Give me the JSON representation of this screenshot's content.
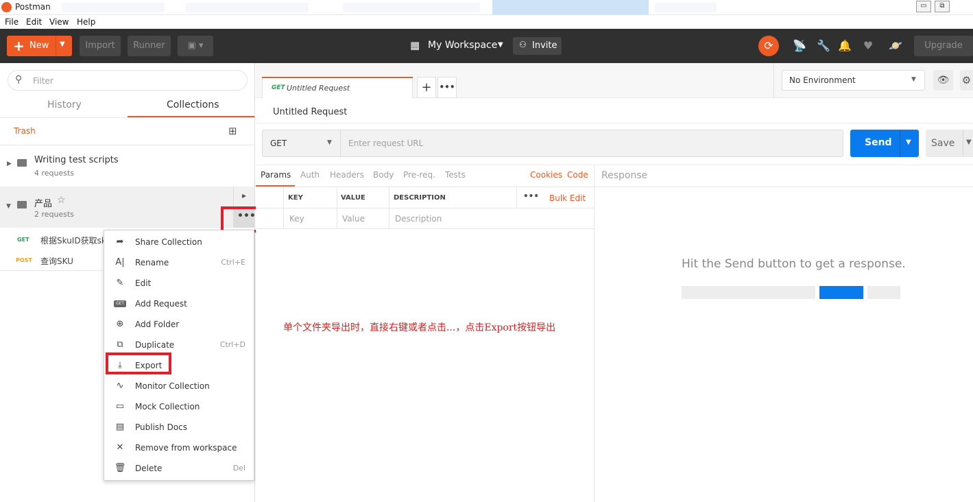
{
  "window": {
    "title": "Postman",
    "minimize": "▭",
    "restore": "⧉"
  },
  "menubar": {
    "file": "File",
    "edit": "Edit",
    "view": "View",
    "help": "Help"
  },
  "header": {
    "new_label": "New",
    "import_label": "Import",
    "runner_label": "Runner",
    "workspace": "My Workspace",
    "invite": "Invite",
    "upgrade": "Upgrade"
  },
  "sidebar": {
    "filter_placeholder": "Filter",
    "tabs": {
      "history": "History",
      "collections": "Collections"
    },
    "trash": "Trash",
    "collections": [
      {
        "name": "Writing test scripts",
        "count": "4 requests"
      },
      {
        "name": "产品",
        "count": "2 requests"
      }
    ],
    "requests": [
      {
        "method": "GET",
        "name": "根据SkuID获取sk"
      },
      {
        "method": "POST",
        "name": "查询SKU"
      }
    ]
  },
  "context_menu": {
    "items": [
      {
        "icon": "➦",
        "label": "Share Collection",
        "shortcut": ""
      },
      {
        "icon": "A|",
        "label": "Rename",
        "shortcut": "Ctrl+E"
      },
      {
        "icon": "✎",
        "label": "Edit",
        "shortcut": ""
      },
      {
        "icon": "GET",
        "label": "Add Request",
        "shortcut": ""
      },
      {
        "icon": "⊕",
        "label": "Add Folder",
        "shortcut": ""
      },
      {
        "icon": "⧉",
        "label": "Duplicate",
        "shortcut": "Ctrl+D"
      },
      {
        "icon": "⤓",
        "label": "Export",
        "shortcut": ""
      },
      {
        "icon": "∿",
        "label": "Monitor Collection",
        "shortcut": ""
      },
      {
        "icon": "▭",
        "label": "Mock Collection",
        "shortcut": ""
      },
      {
        "icon": "▤",
        "label": "Publish Docs",
        "shortcut": ""
      },
      {
        "icon": "✕",
        "label": "Remove from workspace",
        "shortcut": ""
      },
      {
        "icon": "🗑",
        "label": "Delete",
        "shortcut": "Del"
      }
    ]
  },
  "request": {
    "tab_method": "GET",
    "tab_name": "Untitled Request",
    "title": "Untitled Request",
    "method": "GET",
    "url_placeholder": "Enter request URL",
    "send": "Send",
    "save": "Save",
    "environment": "No Environment"
  },
  "params": {
    "tabs": [
      "Params",
      "Auth",
      "Headers",
      "Body",
      "Pre-req.",
      "Tests"
    ],
    "cookies": "Cookies",
    "code": "Code",
    "columns": {
      "key": "KEY",
      "value": "VALUE",
      "description": "DESCRIPTION"
    },
    "bulk_edit": "Bulk Edit",
    "placeholders": {
      "key": "Key",
      "value": "Value",
      "description": "Description"
    }
  },
  "response": {
    "title": "Response",
    "hint": "Hit the Send button to get a response."
  },
  "annotation": "单个文件夹导出时，直接右键或者点击...，点击Export按钮导出",
  "colors": {
    "accent": "#ef5b25",
    "send_blue": "#097bed",
    "header_bg": "#303030",
    "highlight_red": "#e0202b",
    "get_green": "#2e9c5b",
    "post_orange": "#e9a426"
  }
}
